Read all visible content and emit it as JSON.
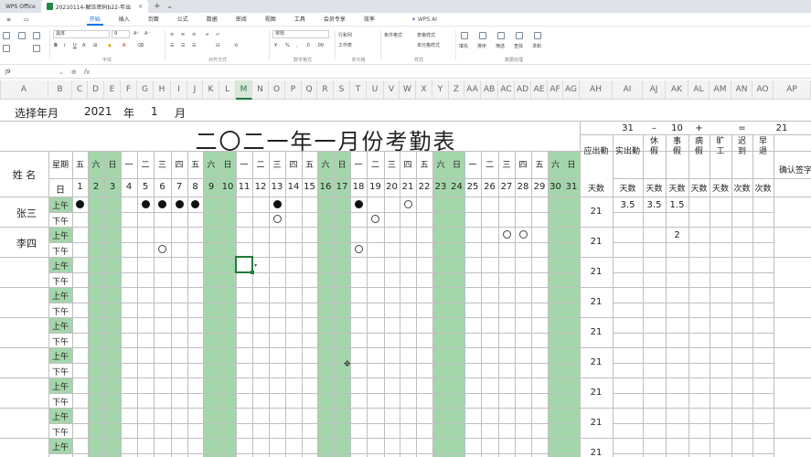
{
  "titlebar": {
    "tabs": [
      {
        "label": "WPS Office",
        "active": false
      },
      {
        "label": "20210114-解压密码b22-年出",
        "active": true
      }
    ]
  },
  "menubar": {
    "items": [
      "开始",
      "插入",
      "页面",
      "公式",
      "数据",
      "审阅",
      "视图",
      "工具",
      "会员专享",
      "效率"
    ],
    "active_index": 0,
    "ai_label": "WPS AI"
  },
  "ribbon": {
    "font_name": "黑体",
    "font_size": "9",
    "number_format": "常规",
    "group_labels": [
      "字体",
      "对齐方式",
      "数字格式",
      "单元格",
      "样式",
      "数据处理"
    ],
    "items": [
      "行和列",
      "工作表",
      "条件格式",
      "表格样式",
      "单元格样式",
      "填充",
      "排序",
      "筛选",
      "查找",
      "求和"
    ]
  },
  "formulabar": {
    "cell_ref": "J9",
    "fx": "fx"
  },
  "columns": [
    "A",
    "B",
    "C",
    "D",
    "E",
    "F",
    "G",
    "H",
    "I",
    "J",
    "K",
    "L",
    "M",
    "N",
    "O",
    "P",
    "Q",
    "R",
    "S",
    "T",
    "U",
    "V",
    "W",
    "X",
    "Y",
    "Z",
    "AA",
    "AB",
    "AC",
    "AD",
    "AE",
    "AF",
    "AG",
    "AH",
    "AI",
    "AJ",
    "AK",
    "AL",
    "AM",
    "AN",
    "AO",
    "AP"
  ],
  "selected_column": "M",
  "sheet": {
    "header": {
      "label": "选择年月",
      "year": "2021",
      "year_unit": "年",
      "month": "1",
      "month_unit": "月"
    },
    "title": "二〇二一年一月份考勤表",
    "formula_row": {
      "n1": "31",
      "op1": "–",
      "n2": "10",
      "op2": "+",
      "eq": "=",
      "result": "21"
    },
    "name_header": "姓 名",
    "weekday_label": "星期",
    "day_label": "日",
    "weekdays": [
      "五",
      "六",
      "日",
      "一",
      "二",
      "三",
      "四",
      "五",
      "六",
      "日",
      "一",
      "二",
      "三",
      "四",
      "五",
      "六",
      "日",
      "一",
      "二",
      "三",
      "四",
      "五",
      "六",
      "日",
      "一",
      "二",
      "三",
      "四",
      "五",
      "六",
      "日"
    ],
    "days": [
      "1",
      "2",
      "3",
      "4",
      "5",
      "6",
      "7",
      "8",
      "9",
      "10",
      "11",
      "12",
      "13",
      "14",
      "15",
      "16",
      "17",
      "18",
      "19",
      "20",
      "21",
      "22",
      "23",
      "24",
      "25",
      "26",
      "27",
      "28",
      "29",
      "30",
      "31"
    ],
    "weekend_days": [
      2,
      3,
      9,
      10,
      16,
      17,
      23,
      24,
      30,
      31
    ],
    "summary_headers": {
      "due": "应出勤",
      "actual": "实出勤",
      "rest": "休假",
      "personal": "事假",
      "sick": "病假",
      "absent": "旷工",
      "late": "迟到",
      "early": "早退",
      "confirm": "确认签字"
    },
    "summary_sub": {
      "due": "天数",
      "actual": "天数",
      "rest": "天数",
      "personal": "天数",
      "sick": "天数",
      "absent": "天数",
      "late": "次数",
      "early": "次数"
    },
    "am_label": "上午",
    "pm_label": "下午",
    "employees": [
      {
        "name": "张三",
        "am_dots": [
          1,
          5,
          6,
          7,
          8,
          13,
          18
        ],
        "am_rings": [
          21
        ],
        "pm_dots": [],
        "pm_rings": [
          13,
          19
        ],
        "due": "21",
        "actual": "3.5",
        "rest": "3.5",
        "personal": "1.5",
        "sick": ""
      },
      {
        "name": "李四",
        "am_dots": [],
        "am_rings": [
          27,
          28
        ],
        "pm_dots": [],
        "pm_rings": [
          6,
          18
        ],
        "due": "21",
        "actual": "",
        "rest": "",
        "personal": "2",
        "sick": ""
      },
      {
        "name": "",
        "am_dots": [],
        "am_rings": [],
        "pm_dots": [],
        "pm_rings": [],
        "due": "21",
        "actual": "",
        "rest": "",
        "personal": "",
        "sick": ""
      },
      {
        "name": "",
        "am_dots": [],
        "am_rings": [],
        "pm_dots": [],
        "pm_rings": [],
        "due": "21",
        "actual": "",
        "rest": "",
        "personal": "",
        "sick": ""
      },
      {
        "name": "",
        "am_dots": [],
        "am_rings": [],
        "pm_dots": [],
        "pm_rings": [],
        "due": "21",
        "actual": "",
        "rest": "",
        "personal": "",
        "sick": ""
      },
      {
        "name": "",
        "am_dots": [],
        "am_rings": [],
        "pm_dots": [],
        "pm_rings": [],
        "due": "21",
        "actual": "",
        "rest": "",
        "personal": "",
        "sick": ""
      },
      {
        "name": "",
        "am_dots": [],
        "am_rings": [],
        "pm_dots": [],
        "pm_rings": [],
        "due": "21",
        "actual": "",
        "rest": "",
        "personal": "",
        "sick": ""
      },
      {
        "name": "",
        "am_dots": [],
        "am_rings": [],
        "pm_dots": [],
        "pm_rings": [],
        "due": "21",
        "actual": "",
        "rest": "",
        "personal": "",
        "sick": ""
      },
      {
        "name": "",
        "am_dots": [],
        "am_rings": [],
        "pm_dots": [],
        "pm_rings": [],
        "due": "21",
        "actual": "",
        "rest": "",
        "personal": "",
        "sick": ""
      }
    ]
  },
  "colors": {
    "weekend_green": "#a4d6ab",
    "accent": "#1e7b3c",
    "grid": "#bfbfbf"
  }
}
